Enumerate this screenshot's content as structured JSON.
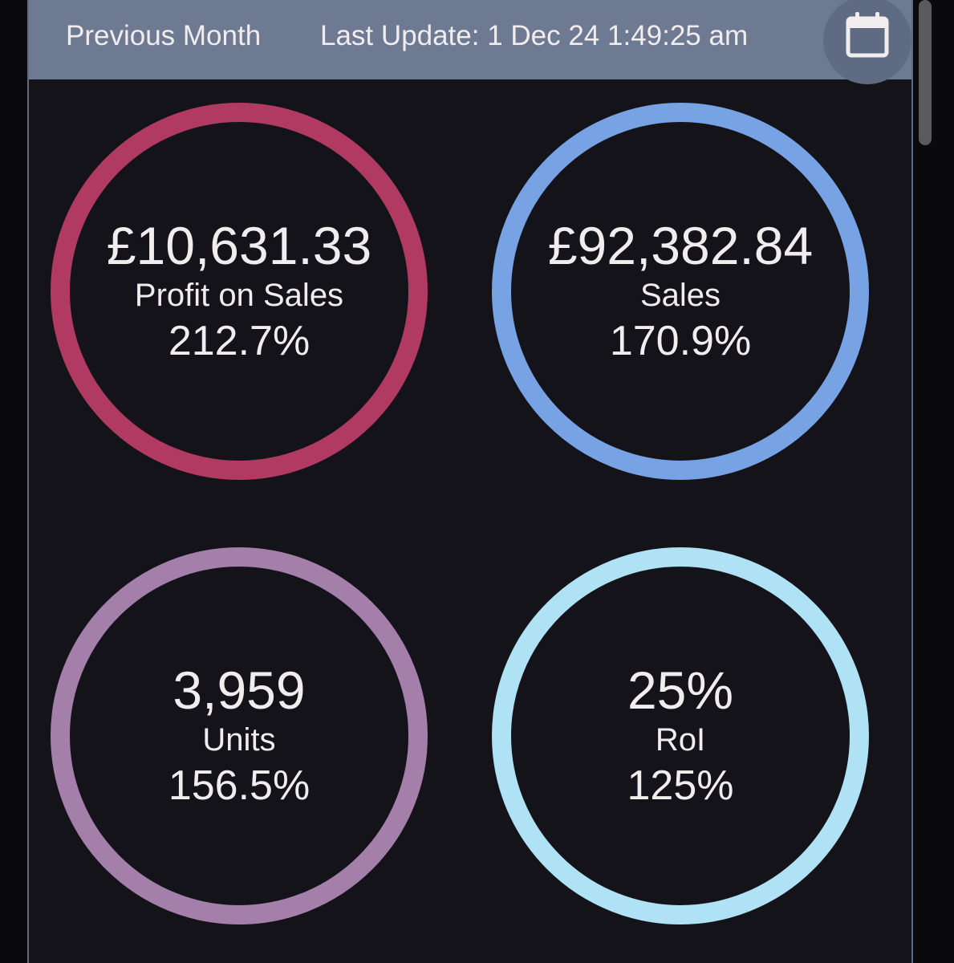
{
  "header": {
    "period_label": "Previous Month",
    "last_update": "Last Update: 1 Dec 24 1:49:25 am",
    "calendar_icon": "calendar-icon"
  },
  "colors": {
    "header_bg": "#6e7a92",
    "panel_bg": "#14131a",
    "text": "#f1ecee"
  },
  "kpis": [
    {
      "value": "£10,631.33",
      "label": "Profit on Sales",
      "percent": "212.7%",
      "ring_color": "#b03a62"
    },
    {
      "value": "£92,382.84",
      "label": "Sales",
      "percent": "170.9%",
      "ring_color": "#77a3e4"
    },
    {
      "value": "3,959",
      "label": "Units",
      "percent": "156.5%",
      "ring_color": "#a37fa9"
    },
    {
      "value": "25%",
      "label": "RoI",
      "percent": "125%",
      "ring_color": "#aee2f4"
    }
  ]
}
